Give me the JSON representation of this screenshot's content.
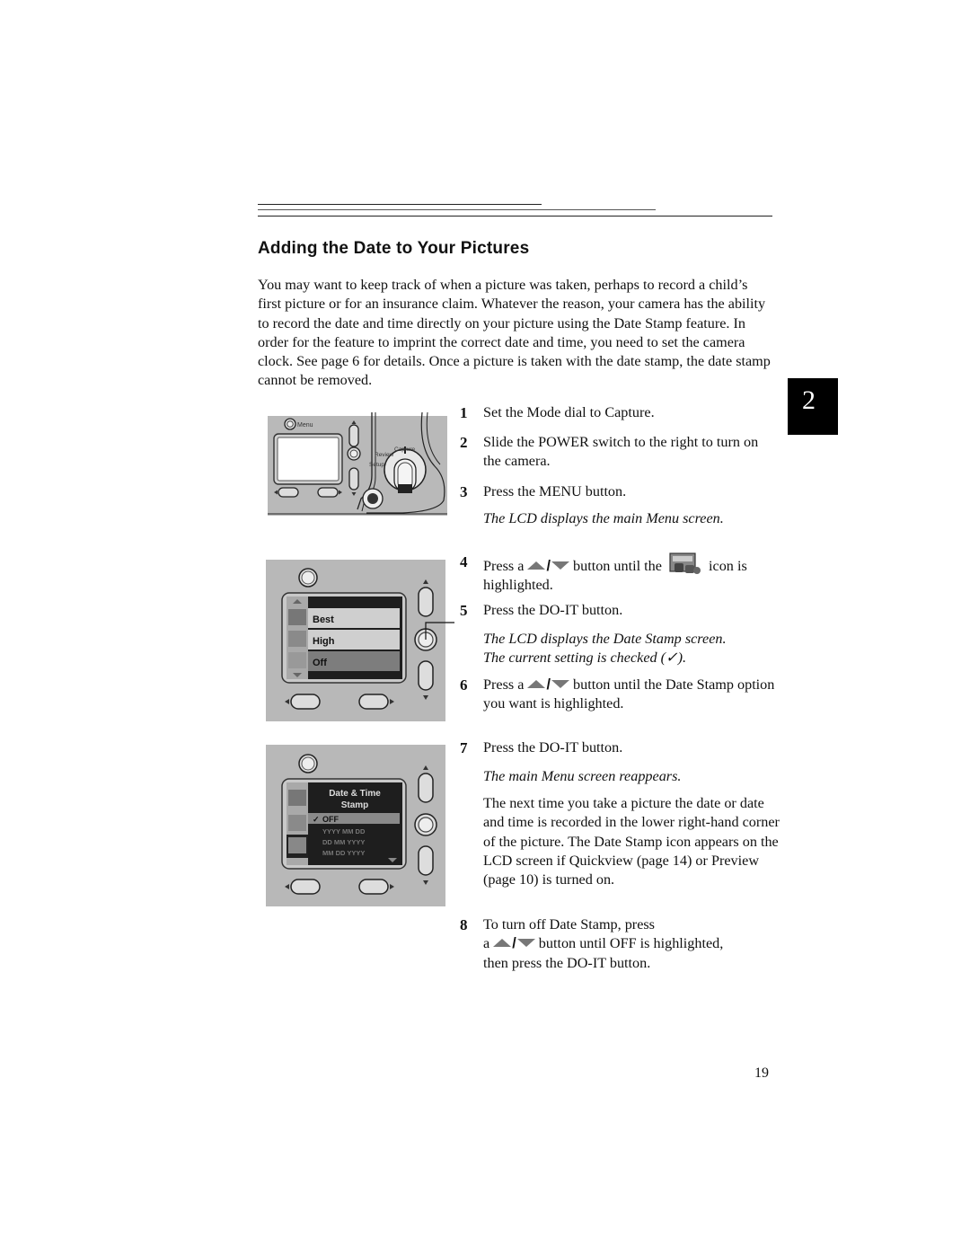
{
  "header": {
    "section_title": "Adding the Date to Your Pictures"
  },
  "intro_paragraph": "You may want to keep track of when a picture was taken, perhaps to record a child’s first picture or for an insurance claim. Whatever the reason, your camera has the ability to record the date and time directly on your picture using the Date Stamp feature. In order for the feature to imprint the correct date and time, you need to set the camera clock. See page 6 for details. Once a picture is taken with the date stamp, the date stamp cannot be removed.",
  "chapter_tab": "2",
  "page_number": "19",
  "steps": [
    {
      "number": "1",
      "text": "Set the Mode dial to Capture."
    },
    {
      "number": "2",
      "text": "Slide the POWER switch to the right to turn on the camera."
    },
    {
      "number": "3",
      "text": "Press the MENU button.",
      "note": "The LCD displays the main Menu screen."
    },
    {
      "number": "4",
      "text_before": "Press a",
      "text_mid": "button until the",
      "text_after": "icon is highlighted.",
      "icon": "date-stamp-icon"
    },
    {
      "number": "5",
      "text": "Press the DO-IT button.",
      "note_line1": "The LCD displays the Date Stamp screen.",
      "note_line2_before": "The current setting is checked (",
      "note_check": "✓",
      "note_line2_after": ")."
    },
    {
      "number": "6",
      "text_before": "Press a",
      "text_after": "button until the Date Stamp option you want is highlighted."
    },
    {
      "number": "7",
      "text": "Press the DO-IT button.",
      "note": "The main Menu screen reappears.",
      "paragraph": "The next time you take a picture the date or date and time is recorded in the lower right-hand corner of the picture. The Date Stamp icon appears on the LCD screen if Quickview (page 14) or Preview",
      "paragraph_end": "(page 10) is turned on."
    },
    {
      "number": "8",
      "text_line1": "To turn off Date Stamp, press",
      "text_line2_before": "a",
      "text_line2_after": "button until OFF is highlighted,",
      "text_line3": "then press the DO-IT button."
    }
  ],
  "figures": {
    "camera_back": {
      "menu_label": "Menu",
      "dial_labels": {
        "capture": "Capture",
        "review": "Review",
        "setup": "Setup"
      }
    },
    "main_menu_lcd": {
      "items": [
        "Best",
        "High",
        "Off"
      ],
      "highlighted": "Off"
    },
    "date_stamp_lcd": {
      "title_line1": "Date & Time",
      "title_line2": "Stamp",
      "options": [
        "OFF",
        "YYYY MM DD",
        "DD MM YYYY",
        "MM DD YYYY"
      ],
      "checked": "OFF",
      "check_mark": "✓"
    }
  },
  "colors": {
    "figure_gray": "#b8b8b8",
    "lcd_dark": "#1e1e1e",
    "highlight_gray": "#8a8a8a",
    "chapter_tab_bg": "#000000"
  }
}
